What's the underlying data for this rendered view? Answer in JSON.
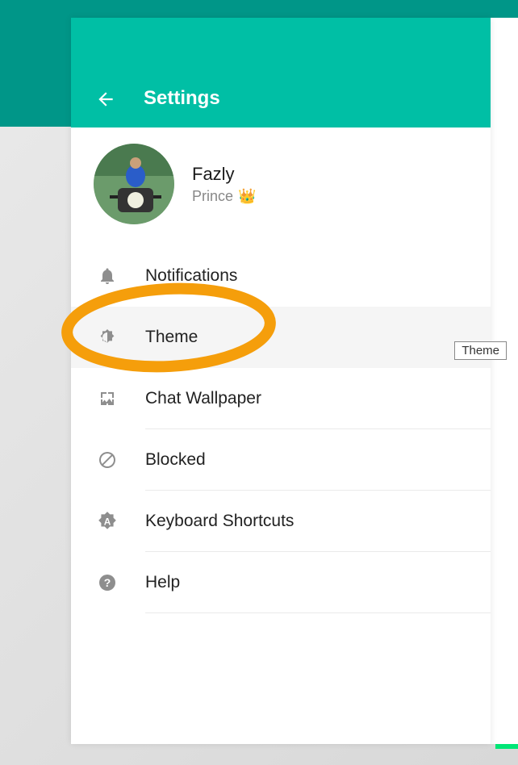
{
  "header": {
    "title": "Settings"
  },
  "profile": {
    "name": "Fazly",
    "status": "Prince",
    "emoji": "👑"
  },
  "menu": {
    "notifications": "Notifications",
    "theme": "Theme",
    "chat_wallpaper": "Chat Wallpaper",
    "blocked": "Blocked",
    "keyboard_shortcuts": "Keyboard Shortcuts",
    "help": "Help"
  },
  "tooltip": "Theme"
}
